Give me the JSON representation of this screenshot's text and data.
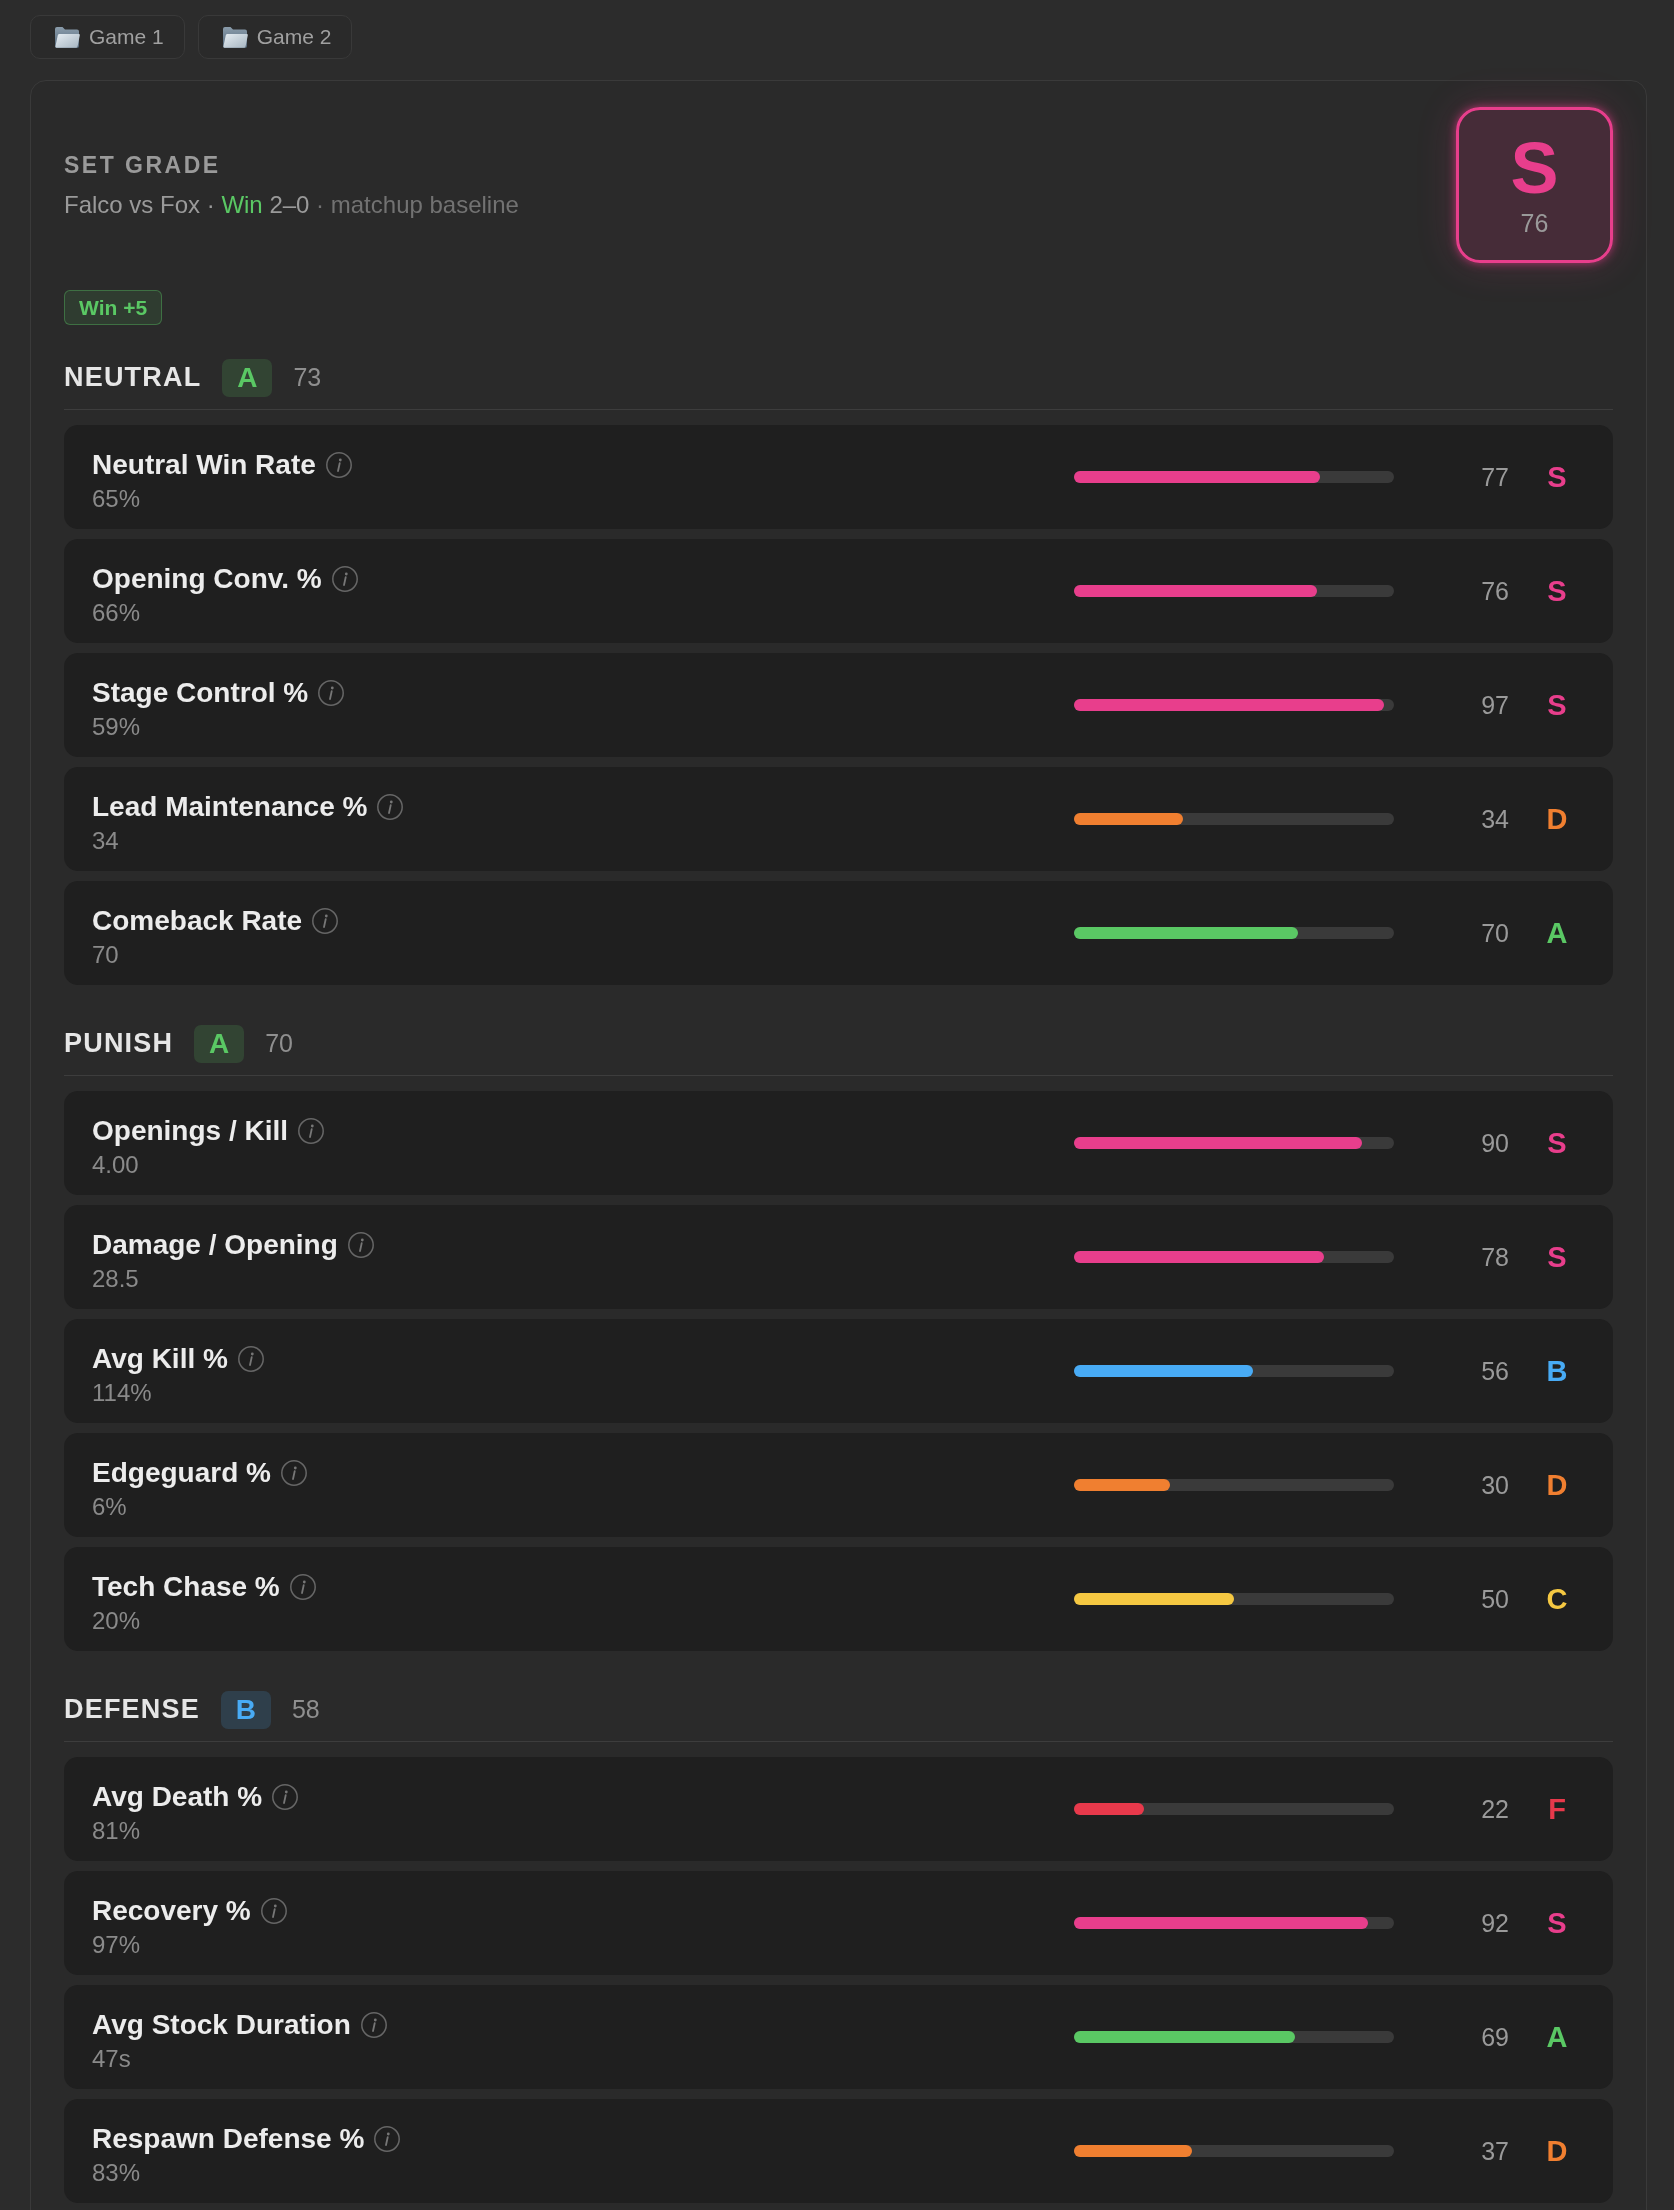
{
  "tabs": [
    {
      "label": "Game 1"
    },
    {
      "label": "Game 2"
    }
  ],
  "set_grade": {
    "title": "SET GRADE",
    "summary": [
      {
        "text": "Falco vs Fox ·",
        "kind": "text"
      },
      {
        "text": "Win",
        "kind": "result"
      },
      {
        "text": "2–0",
        "kind": "text"
      },
      {
        "text": "· matchup baseline",
        "kind": "muted"
      }
    ],
    "grade": "S",
    "score": "76",
    "color": "#e83e8c",
    "modifiers": [
      {
        "label": "Win +5",
        "kind": "bonus"
      }
    ]
  },
  "sections": [
    {
      "title": "NEUTRAL",
      "grade": "A",
      "score": "73",
      "color": "#5ac864",
      "metrics": [
        {
          "name": "Neutral Win Rate",
          "value": "65%",
          "level": 0.77,
          "score": "77",
          "grade": "S",
          "color": "#e83e8c"
        },
        {
          "name": "Opening Conv. %",
          "value": "66%",
          "level": 0.76,
          "score": "76",
          "grade": "S",
          "color": "#e83e8c"
        },
        {
          "name": "Stage Control %",
          "value": "59%",
          "level": 0.97,
          "score": "97",
          "grade": "S",
          "color": "#e83e8c"
        },
        {
          "name": "Lead Maintenance %",
          "value": "34",
          "level": 0.34,
          "score": "34",
          "grade": "D",
          "color": "#f07f30"
        },
        {
          "name": "Comeback Rate",
          "value": "70",
          "level": 0.7,
          "score": "70",
          "grade": "A",
          "color": "#5ac864"
        }
      ]
    },
    {
      "title": "PUNISH",
      "grade": "A",
      "score": "70",
      "color": "#5ac864",
      "metrics": [
        {
          "name": "Openings / Kill",
          "value": "4.00",
          "level": 0.9,
          "score": "90",
          "grade": "S",
          "color": "#e83e8c"
        },
        {
          "name": "Damage / Opening",
          "value": "28.5",
          "level": 0.78,
          "score": "78",
          "grade": "S",
          "color": "#e83e8c"
        },
        {
          "name": "Avg Kill %",
          "value": "114%",
          "level": 0.56,
          "score": "56",
          "grade": "B",
          "color": "#48abf5"
        },
        {
          "name": "Edgeguard %",
          "value": "6%",
          "level": 0.3,
          "score": "30",
          "grade": "D",
          "color": "#f07f30"
        },
        {
          "name": "Tech Chase %",
          "value": "20%",
          "level": 0.5,
          "score": "50",
          "grade": "C",
          "color": "#f5c842"
        }
      ]
    },
    {
      "title": "DEFENSE",
      "grade": "B",
      "score": "58",
      "color": "#48abf5",
      "metrics": [
        {
          "name": "Avg Death %",
          "value": "81%",
          "level": 0.22,
          "score": "22",
          "grade": "F",
          "color": "#e8394b"
        },
        {
          "name": "Recovery %",
          "value": "97%",
          "level": 0.92,
          "score": "92",
          "grade": "S",
          "color": "#e83e8c"
        },
        {
          "name": "Avg Stock Duration",
          "value": "47s",
          "level": 0.69,
          "score": "69",
          "grade": "A",
          "color": "#5ac864"
        },
        {
          "name": "Respawn Defense %",
          "value": "83%",
          "level": 0.37,
          "score": "37",
          "grade": "D",
          "color": "#f07f30"
        }
      ]
    }
  ]
}
